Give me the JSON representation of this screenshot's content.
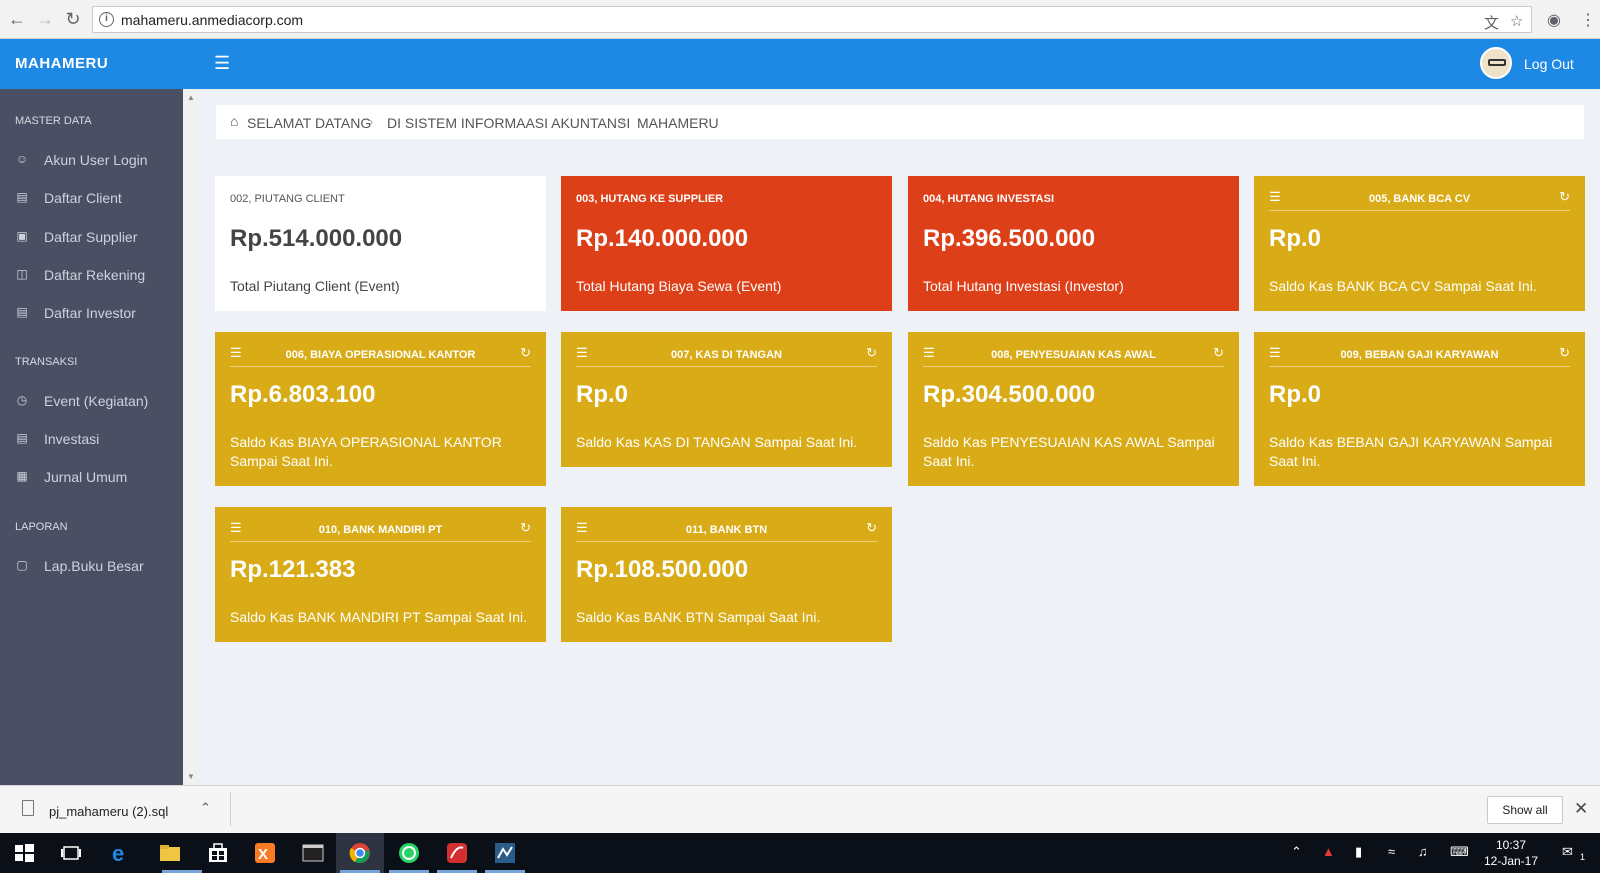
{
  "browser": {
    "url": "mahameru.anmediacorp.com",
    "icons": [
      "back-icon",
      "forward-icon",
      "reload-icon",
      "info-icon",
      "translate-icon",
      "star-icon",
      "extension-icon",
      "menu-icon"
    ]
  },
  "topbar": {
    "brand": "MAHAMERU",
    "logout_label": "Log Out",
    "color": "#1e88e5"
  },
  "sidebar": {
    "sections": [
      {
        "heading": "MASTER DATA",
        "items": [
          {
            "label": "Akun User Login",
            "icon": "user-icon"
          },
          {
            "label": "Daftar Client",
            "icon": "bank-icon"
          },
          {
            "label": "Daftar Supplier",
            "icon": "box-icon"
          },
          {
            "label": "Daftar Rekening",
            "icon": "book-icon"
          },
          {
            "label": "Daftar Investor",
            "icon": "bank-icon"
          }
        ]
      },
      {
        "heading": "TRANSAKSI",
        "items": [
          {
            "label": "Event (Kegiatan)",
            "icon": "clock-icon"
          },
          {
            "label": "Investasi",
            "icon": "wallet-icon"
          },
          {
            "label": "Jurnal Umum",
            "icon": "calendar-icon"
          }
        ]
      },
      {
        "heading": "LAPORAN",
        "items": [
          {
            "label": "Lap.Buku Besar",
            "icon": "clipboard-icon"
          }
        ]
      }
    ]
  },
  "breadcrumb": [
    "SELAMAT DATANG",
    "DI SISTEM INFORMAASI AKUNTANSI",
    "MAHAMERU"
  ],
  "cards": [
    {
      "code": "002, PIUTANG CLIENT",
      "amount": "Rp.514.000.000",
      "desc": "Total Piutang Client (Event)",
      "style": "white"
    },
    {
      "code": "003, HUTANG KE SUPPLIER",
      "amount": "Rp.140.000.000",
      "desc": "Total Hutang Biaya Sewa (Event)",
      "style": "red"
    },
    {
      "code": "004, HUTANG INVESTASI",
      "amount": "Rp.396.500.000",
      "desc": "Total Hutang Investasi (Investor)",
      "style": "red"
    },
    {
      "code": "005, BANK BCA CV",
      "amount": "Rp.0",
      "desc": "Saldo Kas BANK BCA CV Sampai Saat Ini.",
      "style": "gold"
    },
    {
      "code": "006, BIAYA OPERASIONAL KANTOR",
      "amount": "Rp.6.803.100",
      "desc": "Saldo Kas BIAYA OPERASIONAL KANTOR Sampai Saat Ini.",
      "style": "gold"
    },
    {
      "code": "007, KAS DI TANGAN",
      "amount": "Rp.0",
      "desc": "Saldo Kas KAS DI TANGAN Sampai Saat Ini.",
      "style": "gold"
    },
    {
      "code": "008, PENYESUAIAN KAS AWAL",
      "amount": "Rp.304.500.000",
      "desc": "Saldo Kas PENYESUAIAN KAS AWAL Sampai Saat Ini.",
      "style": "gold"
    },
    {
      "code": "009, BEBAN GAJI KARYAWAN",
      "amount": "Rp.0",
      "desc": "Saldo Kas BEBAN GAJI KARYAWAN Sampai Saat Ini.",
      "style": "gold"
    },
    {
      "code": "010, BANK MANDIRI PT",
      "amount": "Rp.121.383",
      "desc": "Saldo Kas BANK MANDIRI PT Sampai Saat Ini.",
      "style": "gold"
    },
    {
      "code": "011, BANK BTN",
      "amount": "Rp.108.500.000",
      "desc": "Saldo Kas BANK BTN Sampai Saat Ini.",
      "style": "gold"
    }
  ],
  "downloads": {
    "file_name": "pj_mahameru (2).sql",
    "show_all_label": "Show all"
  },
  "taskbar": {
    "time": "10:37",
    "date": "12-Jan-17",
    "notification_count": "1"
  },
  "colors": {
    "red": "#dd3f18",
    "gold": "#d9ac17",
    "sidebar": "#4a4f63"
  }
}
